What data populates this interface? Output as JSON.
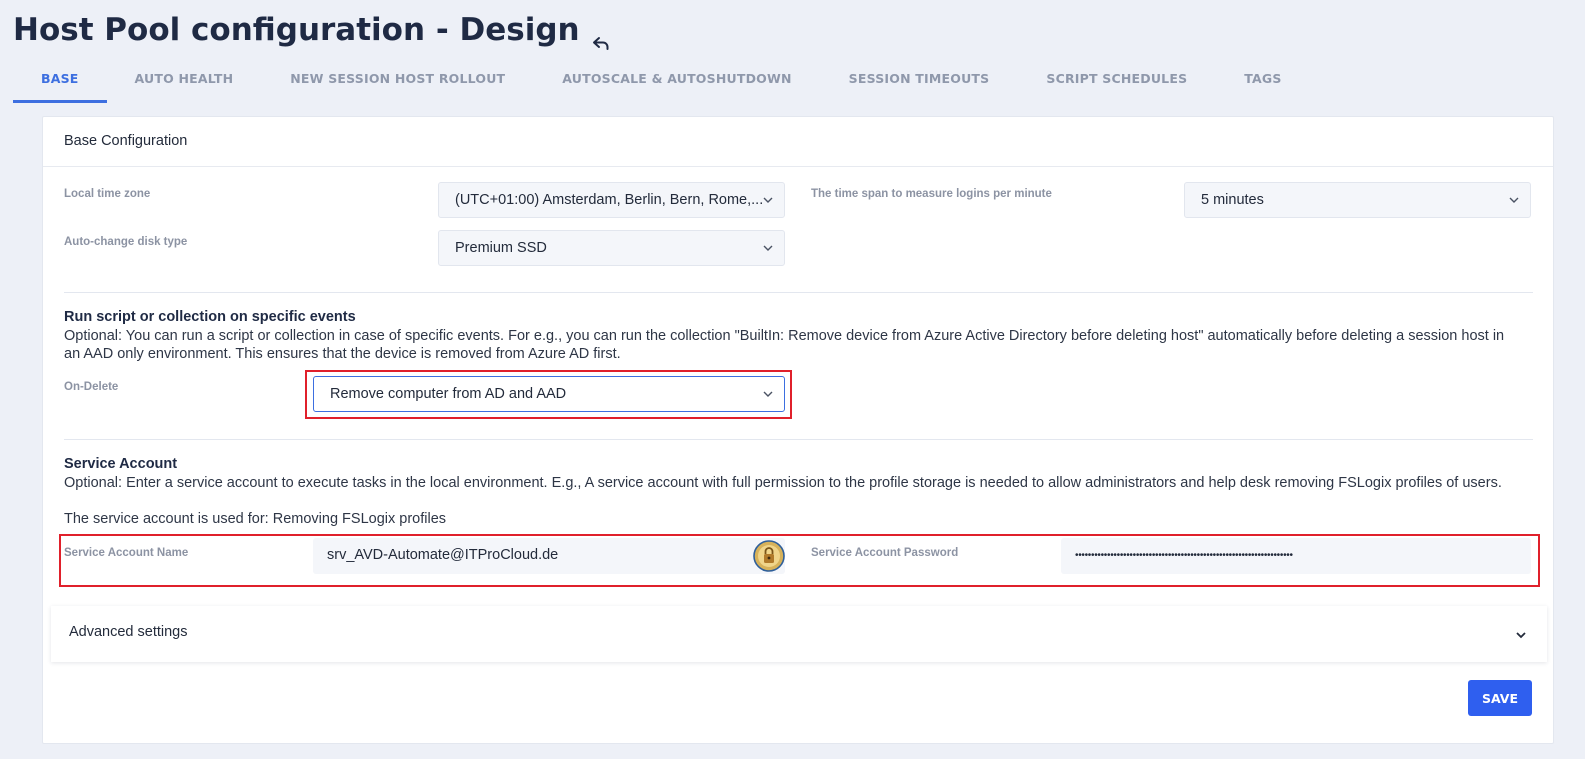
{
  "header": {
    "title": "Host Pool configuration - Design"
  },
  "tabs": [
    {
      "label": "BASE",
      "active": true
    },
    {
      "label": "AUTO HEALTH"
    },
    {
      "label": "NEW SESSION HOST ROLLOUT"
    },
    {
      "label": "AUTOSCALE & AUTOSHUTDOWN"
    },
    {
      "label": "SESSION TIMEOUTS"
    },
    {
      "label": "SCRIPT SCHEDULES"
    },
    {
      "label": "TAGS"
    }
  ],
  "base": {
    "header": "Base Configuration",
    "local_time_zone": {
      "label": "Local time zone",
      "value": "(UTC+01:00) Amsterdam, Berlin, Bern, Rome,..."
    },
    "time_span": {
      "label": "The time span to measure logins per minute",
      "value": "5 minutes"
    },
    "disk_type": {
      "label": "Auto-change disk type",
      "value": "Premium SSD"
    }
  },
  "events": {
    "title": "Run script or collection on specific events",
    "description": "Optional: You can run a script or collection in case of specific events. For e.g., you can run the collection \"BuiltIn: Remove device from Azure Active Directory before deleting host\" automatically before deleting a session host in an AAD only environment. This ensures that the device is removed from Azure AD first.",
    "on_delete": {
      "label": "On-Delete",
      "value": "Remove computer from AD and AAD"
    }
  },
  "service_account": {
    "title": "Service Account",
    "description": "Optional: Enter a service account to execute tasks in the local environment. E.g., A service account with full permission to the profile storage is needed to allow administrators and help desk removing FSLogix profiles of users.",
    "used_for": "The service account is used for: Removing FSLogix profiles",
    "name": {
      "label": "Service Account Name",
      "value": "srv_AVD-Automate@ITProCloud.de"
    },
    "password": {
      "label": "Service Account Password",
      "value": "••••••••••••••••••••••••••••••••••••••••••••••••••••••••••••••••••••"
    }
  },
  "advanced": {
    "label": "Advanced settings"
  },
  "actions": {
    "save_label": "SAVE"
  },
  "colors": {
    "accent": "#3d6fe0",
    "save_button": "#2f5fef",
    "highlight": "#e0202b",
    "background": "#edf0f7"
  },
  "icons": {
    "undo": "undo-icon",
    "chevron": "chevron-down-icon",
    "key": "key-lock-icon"
  }
}
